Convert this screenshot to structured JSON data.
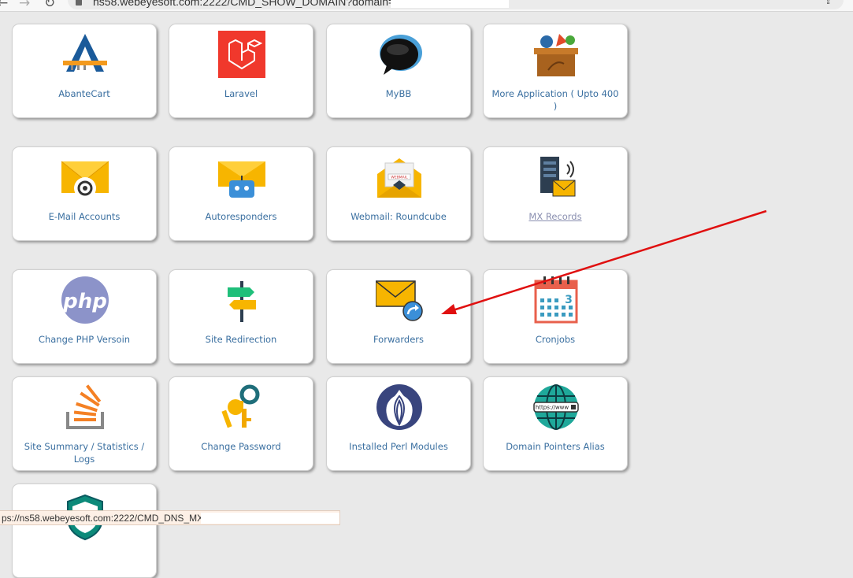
{
  "browser": {
    "url": "ns58.webeyesoft.com:2222/CMD_SHOW_DOMAIN?domain=",
    "back_icon": "back-arrow-icon",
    "forward_icon": "forward-arrow-icon",
    "reload_icon": "reload-icon"
  },
  "tiles": {
    "abantecart": "AbanteCart",
    "laravel": "Laravel",
    "mybb": "MyBB",
    "more_apps": "More Application ( Upto 400 )",
    "email_accounts": "E-Mail Accounts",
    "autoresponders": "Autoresponders",
    "webmail": "Webmail: Roundcube",
    "mx_records": "MX Records",
    "php_version": "Change PHP Versoin",
    "site_redirection": "Site Redirection",
    "forwarders": "Forwarders",
    "cronjobs": "Cronjobs",
    "site_summary": "Site Summary / Statistics / Logs",
    "change_password": "Change Password",
    "perl_modules": "Installed Perl Modules",
    "domain_pointers": "Domain Pointers Alias"
  },
  "icon_text": {
    "php": "php",
    "webmail_badge": "WEBMAIL",
    "www": "https://www"
  },
  "status_bar": {
    "url": "ps://ns58.webeyesoft.com:2222/CMD_DNS_MX?"
  },
  "colors": {
    "label": "#3a6fa0",
    "arrow": "#e01010",
    "laravel": "#f0382c",
    "envelope": "#f7b500"
  }
}
